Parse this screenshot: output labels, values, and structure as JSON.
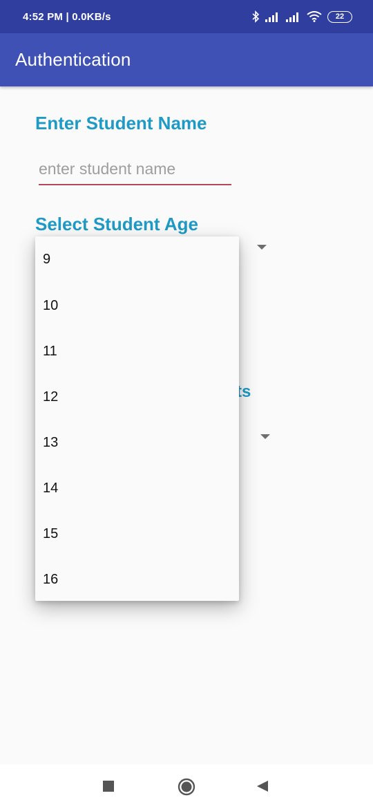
{
  "status_bar": {
    "time_and_speed": "4:52 PM | 0.0KB/s",
    "battery": "22",
    "icons": [
      "bluetooth-icon",
      "signal-icon",
      "signal-icon",
      "wifi-icon",
      "battery-icon"
    ]
  },
  "app_bar": {
    "title": "Authentication"
  },
  "form": {
    "name_label": "Enter Student Name",
    "name_placeholder": "enter student name",
    "name_value": "",
    "age_label": "Select Student Age",
    "partial_label_fragment": "ts"
  },
  "age_dropdown": {
    "options": [
      "9",
      "10",
      "11",
      "12",
      "13",
      "14",
      "15",
      "16"
    ]
  },
  "colors": {
    "status_bar": "#303f9f",
    "app_bar": "#3f51b5",
    "label_accent": "#1e9ac4",
    "input_underline": "#b4485c"
  },
  "navigation_bar": {
    "buttons": [
      "recents-square-icon",
      "home-circle-icon",
      "back-triangle-icon"
    ]
  }
}
